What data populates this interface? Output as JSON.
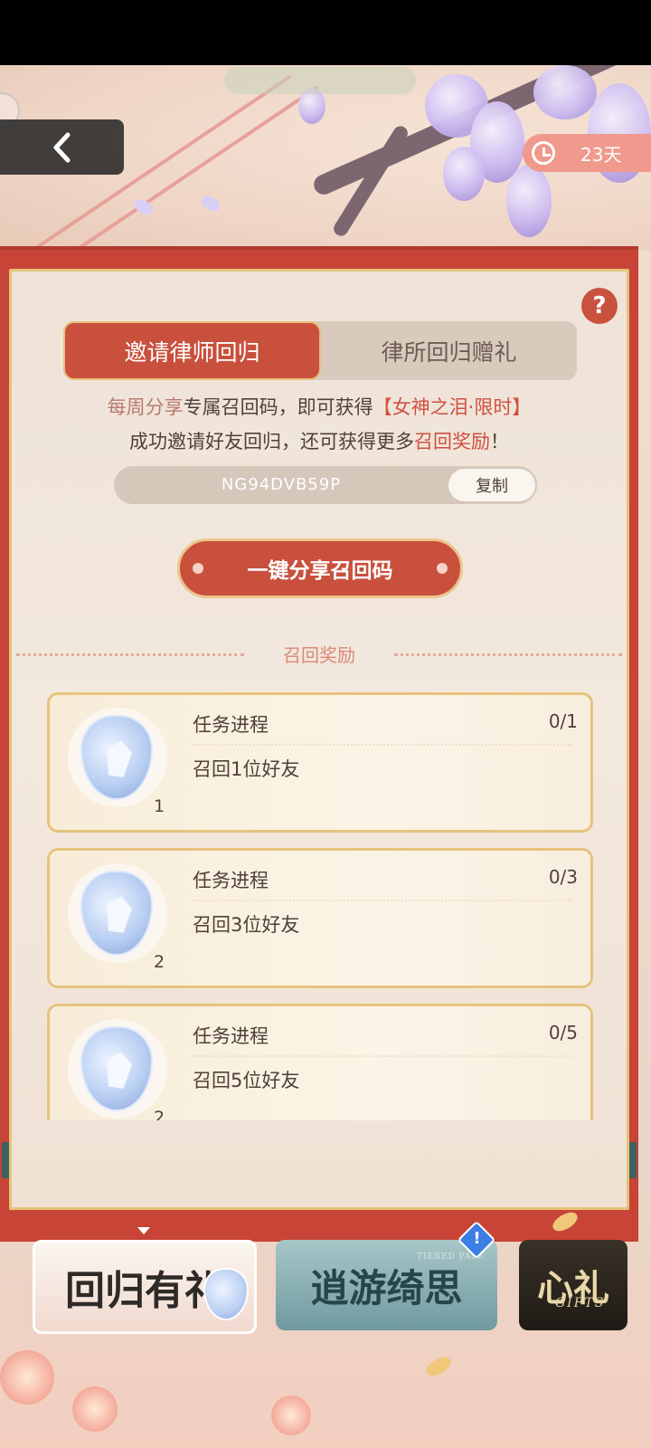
{
  "header": {
    "back_label": "",
    "timer_text": "23天"
  },
  "tabs": [
    {
      "label": "邀请律师回归",
      "active": true
    },
    {
      "label": "律所回归赠礼",
      "active": false
    }
  ],
  "description": {
    "line1_part1": "每周分享",
    "line1_part2": "专属召回码，即可获得",
    "line1_highlight": "【女神之泪·限时】",
    "line2_part1": "成功邀请好友回归，还可获得更多",
    "line2_highlight": "召回奖励",
    "line2_end": "！"
  },
  "recall_code": {
    "value": "NG94DVB59P",
    "copy_label": "复制"
  },
  "share_button_label": "一键分享召回码",
  "rewards_section_title": "召回奖励",
  "tasks": [
    {
      "title": "任务进程",
      "description": "召回1位好友",
      "progress": "0/1",
      "reward_count": "1"
    },
    {
      "title": "任务进程",
      "description": "召回3位好友",
      "progress": "0/3",
      "reward_count": "2"
    },
    {
      "title": "任务进程",
      "description": "召回5位好友",
      "progress": "0/5",
      "reward_count": "2"
    }
  ],
  "bottom_tabs": [
    {
      "label": "回归有礼",
      "sub": ""
    },
    {
      "label": "逍游绮思",
      "sub": "TIERED PASS"
    },
    {
      "label": "心礼",
      "sub": "GIFTS"
    }
  ],
  "colors": {
    "accent_red": "#c8503d",
    "gold_border": "#e6c47e",
    "timer_bg": "#ef9a8c"
  },
  "icons": {
    "back": "chevron-left-icon",
    "timer": "clock-icon",
    "help": "question-icon",
    "reward": "gem-icon",
    "notice": "exclamation-icon"
  }
}
